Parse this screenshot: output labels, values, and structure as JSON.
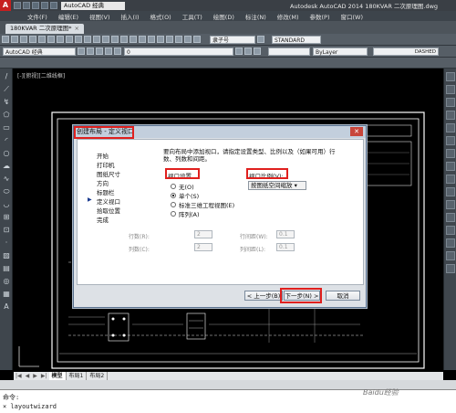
{
  "titlebar": {
    "workspace": "AutoCAD 经典",
    "app_title": "Autodesk AutoCAD 2014    180KVAR 二次原理图.dwg"
  },
  "menubar": [
    "文件(F)",
    "编辑(E)",
    "视图(V)",
    "插入(I)",
    "格式(O)",
    "工具(T)",
    "绘图(D)",
    "标注(N)",
    "修改(M)",
    "参数(P)",
    "窗口(W)"
  ],
  "file_tab": {
    "label": "180KVAR 二次原理图*"
  },
  "toolbar": {
    "workspace_combo": "AutoCAD 经典",
    "layer_combo": "0",
    "linetype_combo": "ByLayer",
    "textstyle_combo": "STANDARD",
    "font_combo": "隶子号",
    "ribbon_right": "DASHED"
  },
  "viewport_label": "[-][俯视][二维线框]",
  "dialog": {
    "title": "创建布局 - 定义视口",
    "steps": [
      "开始",
      "打印机",
      "图纸尺寸",
      "方向",
      "标题栏",
      "定义视口",
      "拾取位置",
      "完成"
    ],
    "current_step": "定义视口",
    "description": "要向布局中添加视口，请指定设置类型、比例以及（如果可用）行数、列数和间距。",
    "viewport_setup_label": "视口设置",
    "viewport_scale_label": "视口比例(V):",
    "scale_value": "按图纸空间缩放",
    "options": [
      "无(O)",
      "单个(S)",
      "标准三维工程视图(E)",
      "阵列(A)"
    ],
    "selected_option": "单个(S)",
    "rows_label": "行数(R):",
    "rows_value": "2",
    "cols_label": "列数(C):",
    "cols_value": "2",
    "row_spacing_label": "行间距(W):",
    "row_spacing_value": "0.1",
    "col_spacing_label": "列间距(L):",
    "col_spacing_value": "0.1",
    "back_button": "< 上一步(B)",
    "next_button": "下一步(N) >",
    "cancel_button": "取消"
  },
  "layout_tabs": [
    "模型",
    "布局1",
    "布局2"
  ],
  "command": {
    "prompt": "命令:",
    "text": "  layoutwizard"
  },
  "watermark": "Baidu经验",
  "colors": {
    "highlight_red": "#e0201e",
    "drawing_bg": "#000000",
    "dialog_bg": "#dde1e6"
  }
}
